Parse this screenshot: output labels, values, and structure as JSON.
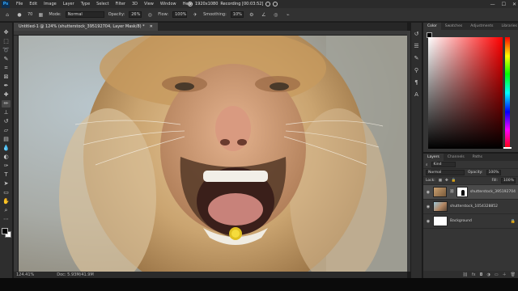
{
  "app": {
    "logo": "Ps",
    "menus": [
      "File",
      "Edit",
      "Image",
      "Layer",
      "Type",
      "Select",
      "Filter",
      "3D",
      "View",
      "Window",
      "Help"
    ],
    "recording": {
      "resolution": "1920x1080",
      "status": "Recording [00:03:52]"
    },
    "window_controls": [
      "—",
      "☐",
      "✕"
    ]
  },
  "options": {
    "mode_label": "Mode:",
    "mode_value": "Normal",
    "opacity_label": "Opacity:",
    "opacity_value": "26%",
    "flow_label": "Flow:",
    "flow_value": "100%",
    "smoothing_label": "Smoothing:",
    "smoothing_value": "10%",
    "brush_size": "70"
  },
  "tools": {
    "icons": [
      "move-icon",
      "marquee-icon",
      "lasso-icon",
      "quick-select-icon",
      "crop-icon",
      "frame-icon",
      "eyedropper-icon",
      "healing-icon",
      "brush-icon",
      "stamp-icon",
      "history-brush-icon",
      "eraser-icon",
      "gradient-icon",
      "blur-icon",
      "dodge-icon",
      "pen-icon",
      "type-icon",
      "path-select-icon",
      "shape-icon",
      "hand-icon",
      "zoom-icon",
      "more-icon"
    ],
    "active_index": 8
  },
  "document": {
    "tab_title": "Untitled-1 @ 124% (shutterstock_395192704, Layer Mask/8) *",
    "zoom": "124.41%",
    "doc_info": "Doc: 5.93M/41.9M"
  },
  "color_panel": {
    "tabs": [
      "Color",
      "Swatches",
      "Adjustments",
      "Libraries"
    ],
    "active_tab": 0,
    "foreground": "#000000",
    "background": "#ffffff"
  },
  "layers_panel": {
    "tabs": [
      "Layers",
      "Channels",
      "Paths"
    ],
    "active_tab": 0,
    "filter_label": "Kind",
    "blend_mode": "Normal",
    "opacity_label": "Opacity:",
    "opacity_value": "100%",
    "lock_label": "Lock:",
    "fill_label": "Fill:",
    "fill_value": "100%",
    "layers": [
      {
        "name": "shutterstock_395192704",
        "selected": true,
        "has_mask": true
      },
      {
        "name": "shutterstock_1054328852",
        "selected": false,
        "has_mask": false
      },
      {
        "name": "Background",
        "selected": false,
        "has_mask": false,
        "locked": true
      }
    ],
    "bottom_icons": [
      "link-icon",
      "fx-icon",
      "mask-icon",
      "adjustment-icon",
      "group-icon",
      "new-layer-icon",
      "trash-icon"
    ]
  }
}
